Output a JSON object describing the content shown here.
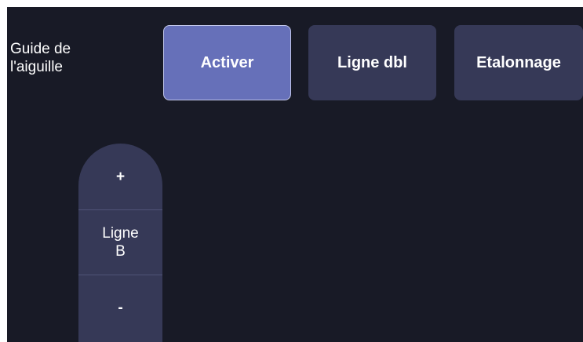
{
  "guide": {
    "label": "Guide de\nl'aiguille"
  },
  "buttons": {
    "activer": "Activer",
    "ligne_dbl": "Ligne dbl",
    "etalonnage": "Etalonnage"
  },
  "stepper": {
    "plus": "+",
    "value": "Ligne\nB",
    "minus": "-"
  },
  "colors": {
    "background": "#181a26",
    "button": "#363957",
    "button_active": "#6670b9",
    "text": "#ffffff"
  }
}
